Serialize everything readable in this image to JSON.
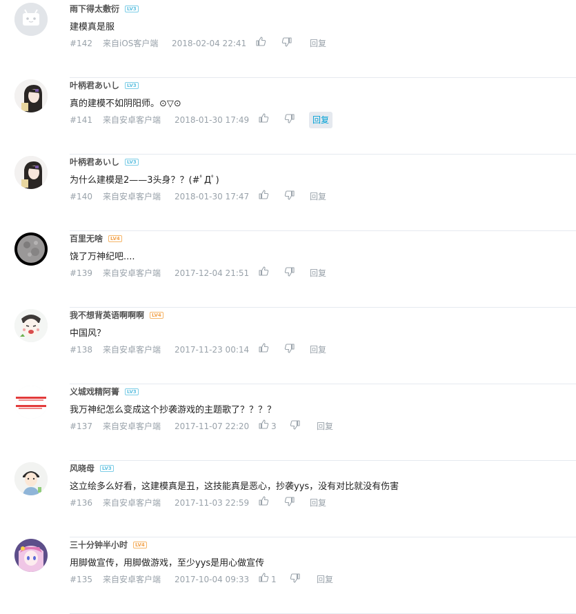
{
  "comments": [
    {
      "user": "雨下得太敷衍",
      "level": "LV3",
      "level_color": "#5ec0e0",
      "text": "建模真是服",
      "floor": "#142",
      "source": "来自iOS客户端",
      "time": "2018-02-04 22:41",
      "likes": "",
      "reply": "回复",
      "reply_active": false,
      "avatar": "tv"
    },
    {
      "user": "叶柄君あいし",
      "level": "LV3",
      "level_color": "#5ec0e0",
      "text": "真的建模不如阴阳师。⊙▽⊙",
      "floor": "#141",
      "source": "来自安卓客户端",
      "time": "2018-01-30 17:49",
      "likes": "",
      "reply": "回复",
      "reply_active": true,
      "avatar": "girl"
    },
    {
      "user": "叶柄君あいし",
      "level": "LV3",
      "level_color": "#5ec0e0",
      "text": "为什么建模是2——3头身？？(#ﾟДﾟ)",
      "floor": "#140",
      "source": "来自安卓客户端",
      "time": "2018-01-30 17:47",
      "likes": "",
      "reply": "回复",
      "reply_active": false,
      "avatar": "girl"
    },
    {
      "user": "百里无啥",
      "level": "LV4",
      "level_color": "#f2a24b",
      "text": "饶了万神纪吧....",
      "floor": "#139",
      "source": "来自安卓客户端",
      "time": "2017-12-04 21:51",
      "likes": "",
      "reply": "回复",
      "reply_active": false,
      "avatar": "moon"
    },
    {
      "user": "我不想背英语啊啊啊",
      "level": "LV4",
      "level_color": "#f2a24b",
      "text": "中国风？",
      "floor": "#138",
      "source": "来自安卓客户端",
      "time": "2017-11-23 00:14",
      "likes": "",
      "reply": "回复",
      "reply_active": false,
      "avatar": "meme"
    },
    {
      "user": "义城戏精阿箐",
      "level": "LV3",
      "level_color": "#5ec0e0",
      "text": "我万神纪怎么变成这个抄袭游戏的主题歌了？？？？",
      "floor": "#137",
      "source": "来自安卓客户端",
      "time": "2017-11-07 22:20",
      "likes": "3",
      "reply": "回复",
      "reply_active": false,
      "avatar": "redtext"
    },
    {
      "user": "风晓母",
      "level": "LV3",
      "level_color": "#5ec0e0",
      "text": "这立绘多么好看，这建模真是丑，这技能真是恶心，抄袭yys，没有对比就没有伤害",
      "floor": "#136",
      "source": "来自安卓客户端",
      "time": "2017-11-03 22:59",
      "likes": "",
      "reply": "回复",
      "reply_active": false,
      "avatar": "kid"
    },
    {
      "user": "三十分钟半小时",
      "level": "LV4",
      "level_color": "#f2a24b",
      "text": "用脚做宣传，用脚做游戏，至少yys是用心做宣传",
      "floor": "#135",
      "source": "来自安卓客户端",
      "time": "2017-10-04 09:33",
      "likes": "1",
      "reply": "回复",
      "reply_active": false,
      "avatar": "anime"
    }
  ]
}
